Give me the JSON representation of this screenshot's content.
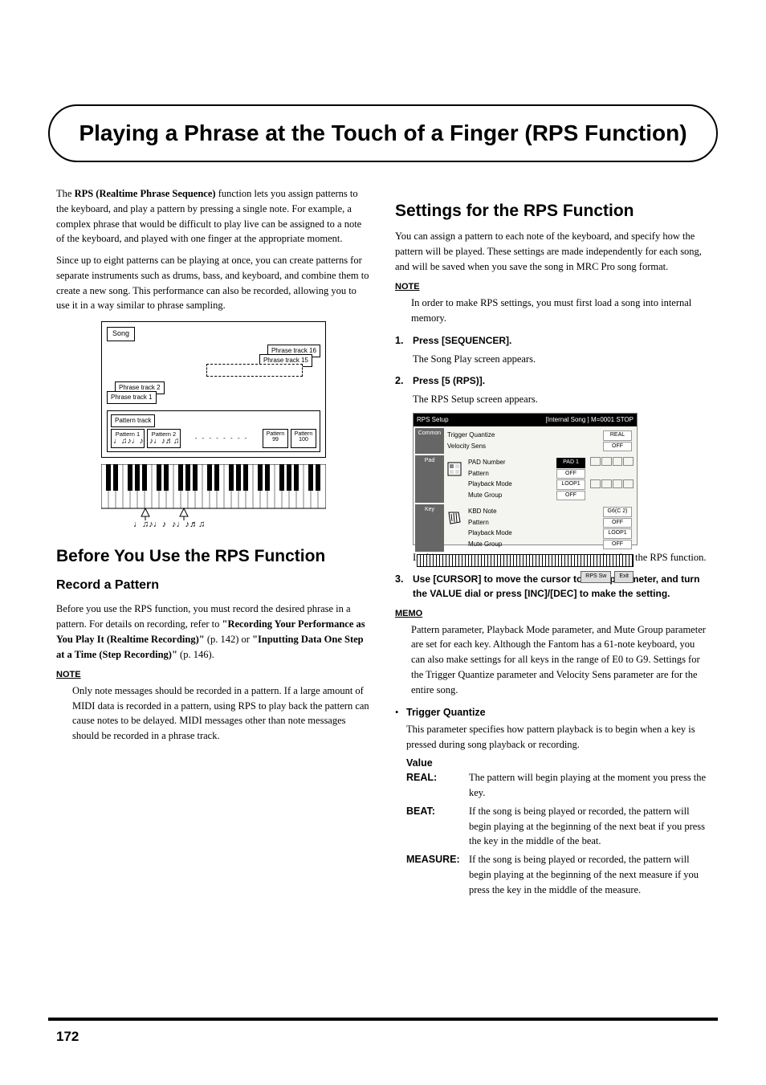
{
  "title": "Playing a Phrase at the Touch of a Finger (RPS Function)",
  "page_number": "172",
  "left": {
    "intro1_pre": "The ",
    "intro1_bold": "RPS (Realtime Phrase Sequence)",
    "intro1_post": " function lets you assign patterns to the keyboard, and play a pattern by pressing a single note. For example, a complex phrase that would be difficult to play live can be assigned to a note of the keyboard, and played with one finger at the appropriate moment.",
    "intro2": "Since up to eight patterns can be playing at once, you can create patterns for separate instruments such as drums, bass, and keyboard, and combine them to create a new song. This performance can also be recorded, allowing you to use it in a way similar to phrase sampling.",
    "diagram": {
      "song": "Song",
      "pt16": "Phrase track 16",
      "pt15": "Phrase track 15",
      "pt2": "Phrase track 2",
      "pt1": "Phrase track 1",
      "pattern_track": "Pattern track",
      "p1": "Pattern 1",
      "p2": "Pattern 2",
      "p99": "Pattern 99",
      "p100": "Pattern 100",
      "wave1": "♩♫♪♩♪",
      "wave2": "♪♩♪♬♫"
    },
    "h2": "Before You Use the RPS Function",
    "h3": "Record a Pattern",
    "record_p1_pre": "Before you use the RPS function, you must record the desired phrase in a pattern. For details on recording, refer to ",
    "record_ref1": "\"Recording Your Performance as You Play It (Realtime Recording)\"",
    "record_ref1_pg": " (p. 142) or ",
    "record_ref2": "\"Inputting Data One Step at a Time (Step Recording)\"",
    "record_ref2_pg": " (p. 146).",
    "note_icon": "NOTE",
    "note1": "Only note messages should be recorded in a pattern. If a large amount of MIDI data is recorded in a pattern, using RPS to play back the pattern can cause notes to be delayed. MIDI messages other than note messages should be recorded in a phrase track."
  },
  "right": {
    "h2": "Settings for the RPS Function",
    "p1": "You can assign a pattern to each note of the keyboard, and specify how the pattern will be played. These settings are made independently for each song, and will be saved when you save the song in MRC Pro song format.",
    "note_icon": "NOTE",
    "note1": "In order to make RPS settings, you must first load a song into internal memory.",
    "step1_label": "Press [SEQUENCER].",
    "step1_desc": "The Song Play screen appears.",
    "step2_label": "Press [5 (RPS)].",
    "step2_desc": "The RPS Setup screen appears.",
    "screenshot": {
      "title": "RPS Setup",
      "title_right": "[Internal Song   ] M=0001  STOP",
      "common": "Common",
      "trig_q": "Trigger Quantize",
      "trig_q_val": "REAL",
      "vel_sens": "Velocity Sens",
      "vel_sens_val": "OFF",
      "pad": "Pad",
      "pad_num": "PAD Number",
      "pad_num_val": "PAD 1",
      "pad_pat": "Pattern",
      "pad_pat_val": "OFF",
      "pad_pb": "Playback Mode",
      "pad_pb_val": "LOOP1",
      "pad_mg": "Mute Group",
      "pad_mg_val": "OFF",
      "key": "Key",
      "kbd_note": "KBD Note",
      "kbd_note_val": "G6(C 2)",
      "key_pat": "Pattern",
      "key_pat_val": "OFF",
      "key_pb": "Playback Mode",
      "key_pb_val": "LOOP1",
      "key_mg": "Mute Group",
      "key_mg_val": "OFF",
      "btn_rps": "RPS Sw",
      "btn_exit": "Exit"
    },
    "ss_caption": "In this screen you can set various parameters related to the RPS function.",
    "step3_label": "Use [CURSOR] to move the cursor to each parameter, and turn the VALUE dial or press [INC]/[DEC] to make the setting.",
    "memo_icon": "MEMO",
    "memo1": "Pattern parameter, Playback Mode parameter, and Mute Group parameter are set for each key. Although the Fantom has a 61-note keyboard, you can also make settings for all keys in the range of E0 to G9. Settings for the Trigger Quantize parameter and Velocity Sens parameter are for the entire song.",
    "param_trig": "Trigger Quantize",
    "param_trig_desc": "This parameter specifies how pattern playback is to begin when a key is pressed during song playback or recording.",
    "value_label": "Value",
    "v_real_k": "REAL:",
    "v_real_t": "The pattern will begin playing at the moment you press the key.",
    "v_beat_k": "BEAT:",
    "v_beat_t": "If the song is being played or recorded, the pattern will begin playing at the beginning of the next beat if you press the key in the middle of the beat.",
    "v_meas_k": "MEASURE:",
    "v_meas_t": "If the song is being played or recorded, the pattern will begin playing at the beginning of the next measure if you press the key in the middle of the measure."
  }
}
